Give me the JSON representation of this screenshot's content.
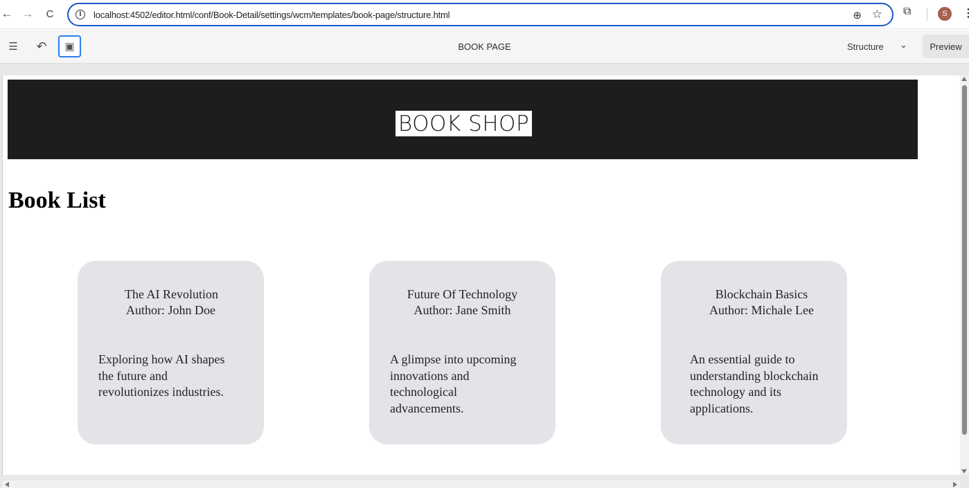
{
  "browser": {
    "url": "localhost:4502/editor.html/conf/Book-Detail/settings/wcm/templates/book-page/structure.html",
    "back_glyph": "←",
    "forward_glyph": "→",
    "reload_glyph": "C",
    "info_glyph": "i",
    "zoom_glyph": "⊕",
    "star_glyph": "☆",
    "extensions_glyph": "⧉",
    "avatar_initial": "S",
    "menu_glyph": "⋮",
    "accent_color": "#1a57c6"
  },
  "toolbar": {
    "settings_glyph": "☰",
    "undo_glyph": "↶",
    "emulator_glyph": "▣",
    "page_title": "BOOK PAGE",
    "mode_label": "Structure",
    "mode_chevron": "⌄",
    "preview_label": "Preview"
  },
  "page": {
    "logo_text": "BOOK SHOP",
    "heading": "Book List",
    "hero_color": "#1d1d1d",
    "card_color": "#e4e3e8",
    "books": [
      {
        "title": "The AI Revolution",
        "author": "Author: John Doe",
        "description": "Exploring how AI shapes the future and revolutionizes industries."
      },
      {
        "title": "Future Of Technology",
        "author": "Author: Jane Smith",
        "description": "A glimpse into upcoming innovations and technological advancements."
      },
      {
        "title": "Blockchain Basics",
        "author": "Author: Michale Lee",
        "description": "An essential guide to understanding blockchain technology and its applications."
      }
    ]
  }
}
